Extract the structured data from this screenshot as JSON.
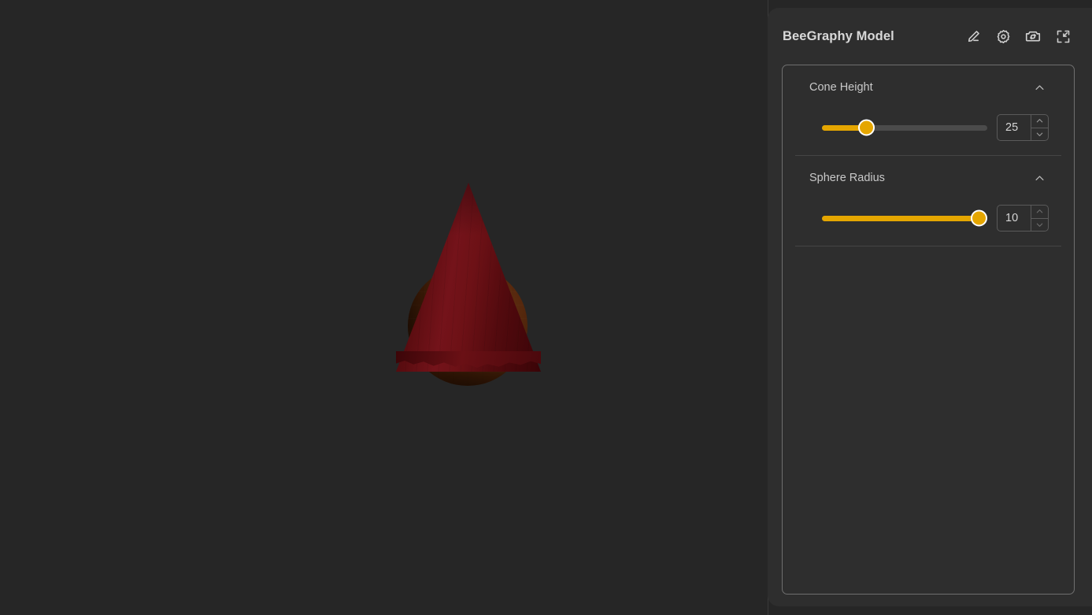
{
  "app": {
    "background_color": "#262626",
    "panel_background_color": "#2e2e2e",
    "accent_color": "#e5a600"
  },
  "viewport": {
    "name": "3d-model-viewport",
    "model": {
      "description": "teardrop shape formed by a dark red cone on top of an orange-brown sphere",
      "cone_color": "#5d0d11",
      "sphere_color": "#5c2b0f"
    }
  },
  "panel": {
    "title": "BeeGraphy Model",
    "header_icons": [
      {
        "name": "edit-icon",
        "label": "Edit"
      },
      {
        "name": "settings-icon",
        "label": "Settings"
      },
      {
        "name": "camera-icon",
        "label": "Screenshot"
      },
      {
        "name": "collapse-icon",
        "label": "Collapse"
      }
    ],
    "collapse_handle": "‹",
    "sections": [
      {
        "title": "Cone Height",
        "collapse_icon": "chevron-up-icon",
        "expanded": true,
        "slider": {
          "value": 25,
          "percent": 27,
          "min": 0,
          "max": 100
        },
        "input": {
          "value": "25",
          "placeholder": "0",
          "up_label": "⌃",
          "down_label": "⌄"
        }
      },
      {
        "title": "Sphere Radius",
        "collapse_icon": "chevron-up-icon",
        "expanded": true,
        "slider": {
          "value": 10,
          "percent": 95,
          "min": 0,
          "max": 100
        },
        "input": {
          "value": "10",
          "placeholder": "0",
          "up_label": "⌃",
          "down_label": "⌄"
        }
      }
    ]
  }
}
